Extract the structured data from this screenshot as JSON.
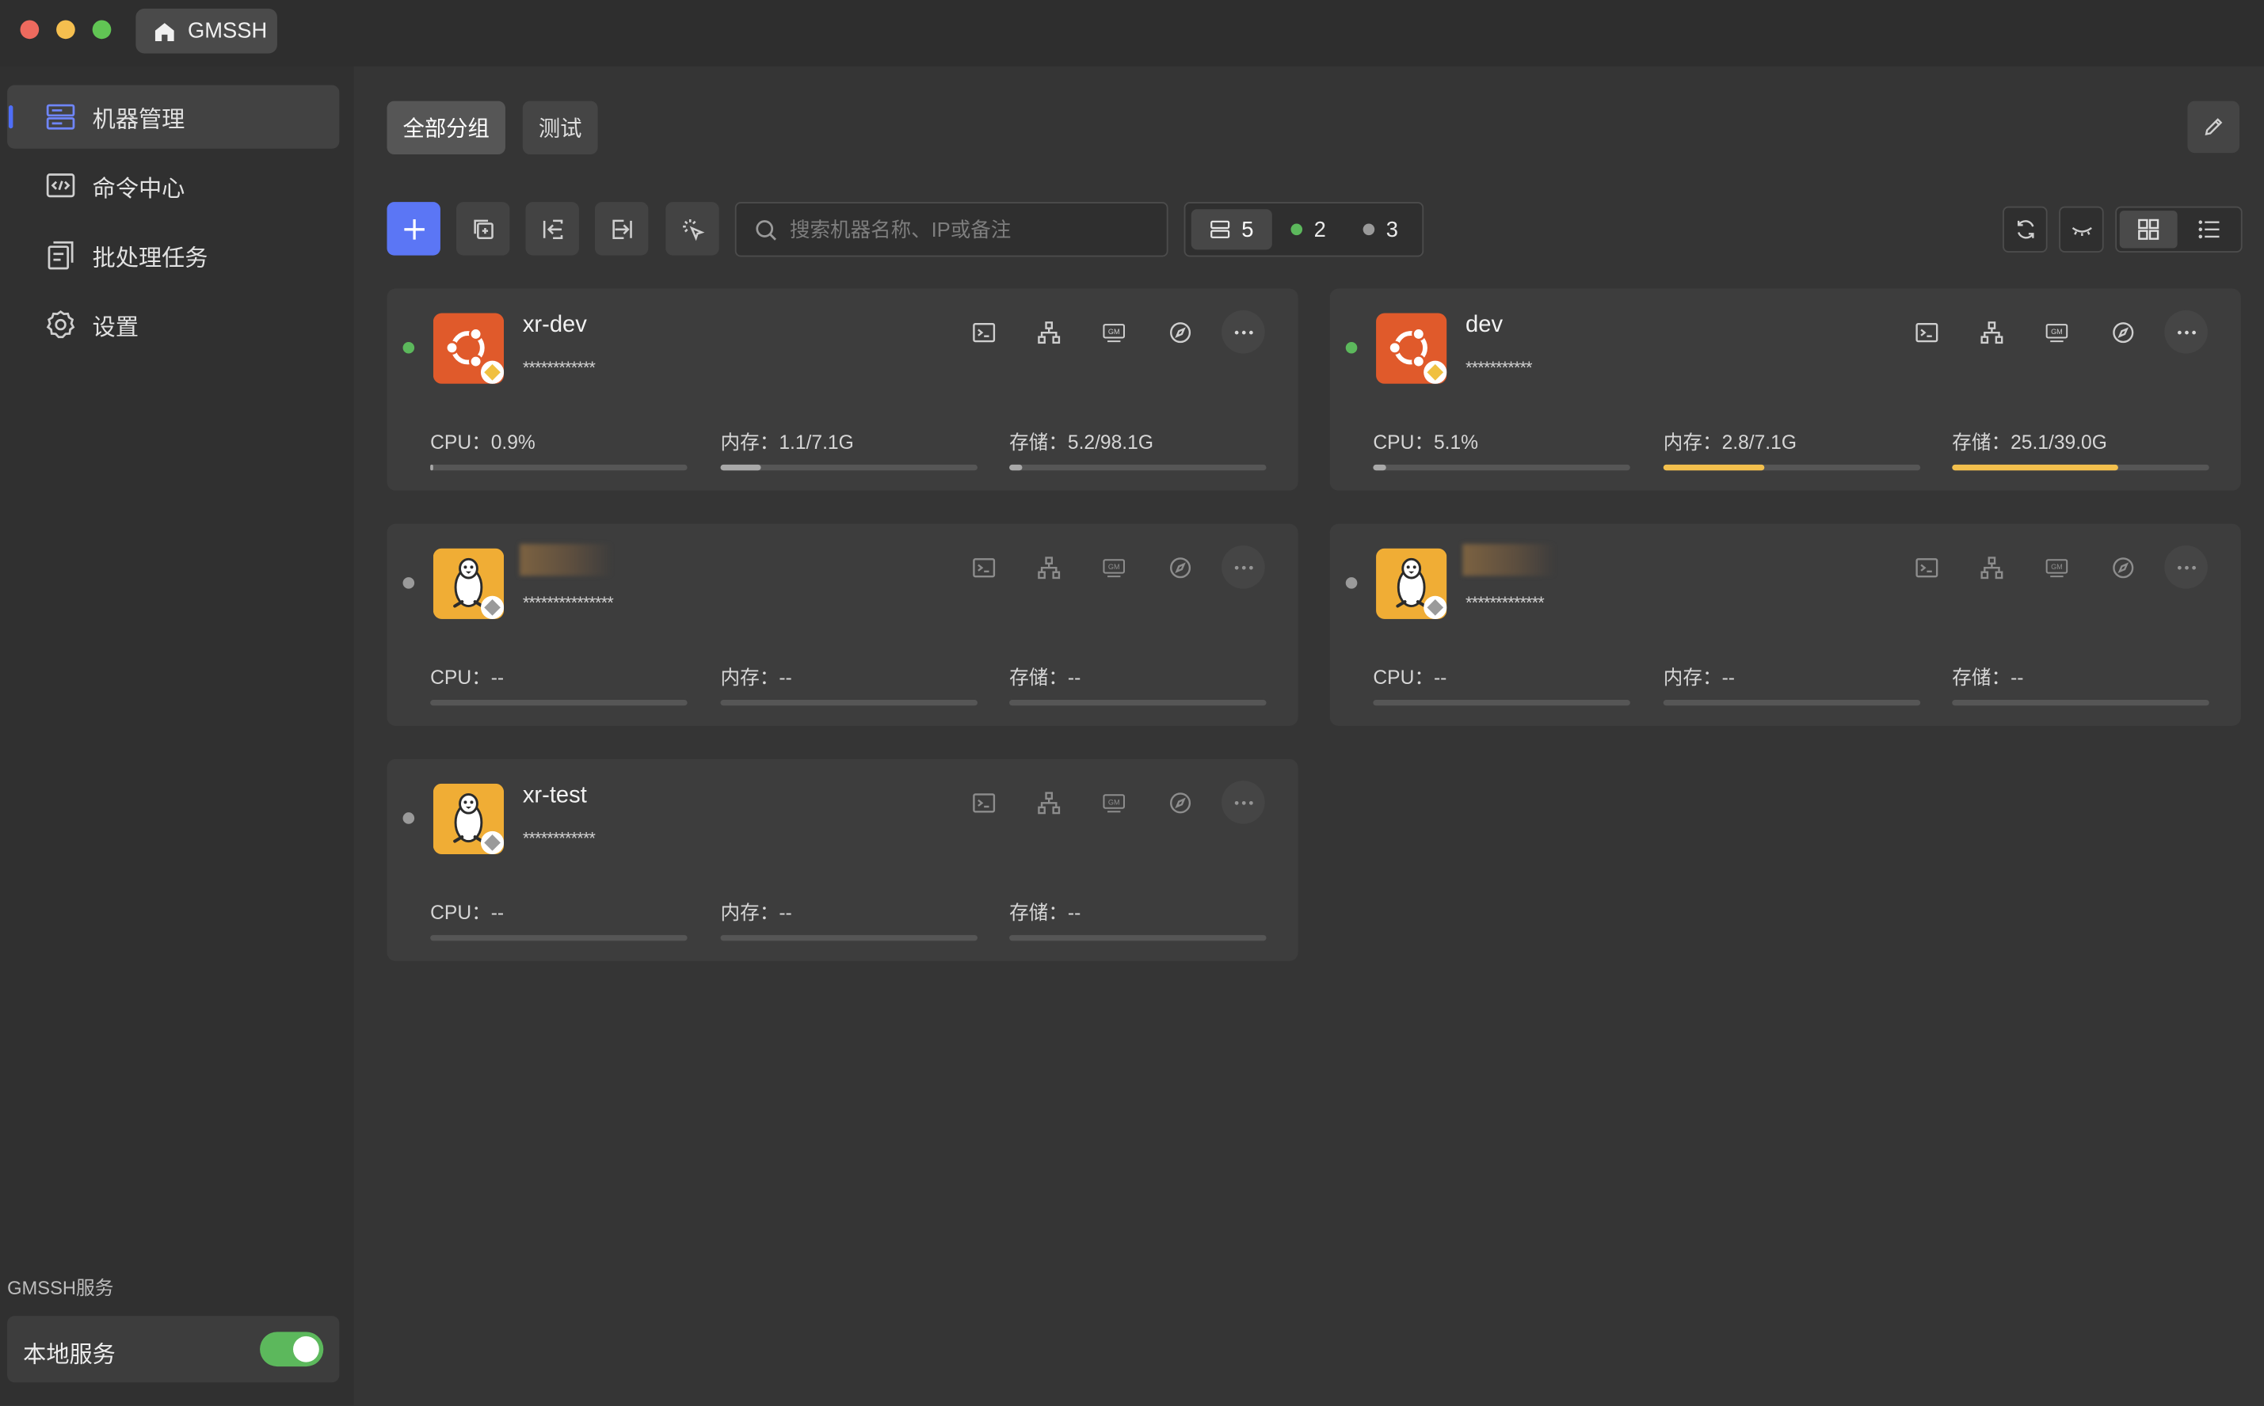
{
  "window": {
    "title": "GMSSH"
  },
  "sidebar": {
    "items": [
      {
        "label": "机器管理",
        "icon": "server-icon",
        "active": true
      },
      {
        "label": "命令中心",
        "icon": "code-icon",
        "active": false
      },
      {
        "label": "批处理任务",
        "icon": "batch-icon",
        "active": false
      },
      {
        "label": "设置",
        "icon": "gear-icon",
        "active": false
      }
    ],
    "service_title": "GMSSH服务",
    "service": {
      "label": "本地服务",
      "enabled": true
    }
  },
  "groups": [
    {
      "label": "全部分组",
      "active": true
    },
    {
      "label": "测试",
      "active": false
    }
  ],
  "toolbar": {
    "search_placeholder": "搜索机器名称、IP或备注",
    "total": "5",
    "online": "2",
    "offline": "3"
  },
  "colors": {
    "accent": "#5b76f5",
    "online": "#5cb85c",
    "offline": "#9a9a9a",
    "bar_fill": "#f3c04d",
    "bar_fill_low": "#a9a9a9",
    "ubuntu": "#e05a2b",
    "linux": "#f0ad35"
  },
  "machines": [
    {
      "name": "xr-dev",
      "host": "************",
      "os": "ubuntu",
      "status": "online",
      "cpu": "CPU：0.9%",
      "mem": "内存：1.1/7.1G",
      "disk": "存储：5.2/98.1G",
      "cpu_frac": 0.009,
      "mem_frac": 0.155,
      "disk_frac": 0.053
    },
    {
      "name": "dev",
      "host": "***********",
      "os": "ubuntu",
      "status": "online",
      "cpu": "CPU：5.1%",
      "mem": "内存：2.8/7.1G",
      "disk": "存储：25.1/39.0G",
      "cpu_frac": 0.051,
      "mem_frac": 0.394,
      "disk_frac": 0.644
    },
    {
      "name": "",
      "host": "***************",
      "os": "linux",
      "status": "offline",
      "cpu": "CPU：--",
      "mem": "内存：--",
      "disk": "存储：--",
      "cpu_frac": 0,
      "mem_frac": 0,
      "disk_frac": 0
    },
    {
      "name": "",
      "host": "*************",
      "os": "linux",
      "status": "offline",
      "cpu": "CPU：--",
      "mem": "内存：--",
      "disk": "存储：--",
      "cpu_frac": 0,
      "mem_frac": 0,
      "disk_frac": 0
    },
    {
      "name": "xr-test",
      "host": "************",
      "os": "linux",
      "status": "offline",
      "cpu": "CPU：--",
      "mem": "内存：--",
      "disk": "存储：--",
      "cpu_frac": 0,
      "mem_frac": 0,
      "disk_frac": 0
    }
  ]
}
